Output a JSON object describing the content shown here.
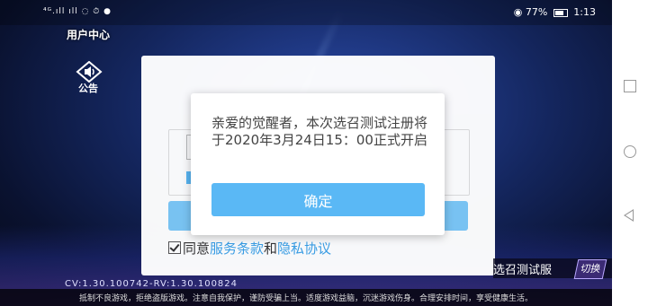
{
  "status_bar": {
    "left": "⁴ᴳ.ıll ıll ◌ ⏱ ●",
    "battery_percent": "77%",
    "time": "1:13"
  },
  "game": {
    "user_center": "用户中心",
    "notice_label": "公告",
    "agree": {
      "prefix": "同意",
      "terms_link": "服务条款",
      "and": "和",
      "privacy_link": "隐私协议"
    },
    "server_name": "选召测试服",
    "switch_button": "切换",
    "version": "CV:1.30.100742-RV:1.30.100824",
    "health_notice": "抵制不良游戏，拒绝盗版游戏。注意自我保护，谨防受骗上当。适度游戏益脑，沉迷游戏伤身。合理安排时间，享受健康生活。"
  },
  "dialog": {
    "message": "亲爱的觉醒者，本次选召测试注册将于2020年3月24日15：00正式开启",
    "confirm_button": "确定"
  },
  "colors": {
    "accent": "#5ab8f5",
    "link": "#3aa0e8"
  }
}
